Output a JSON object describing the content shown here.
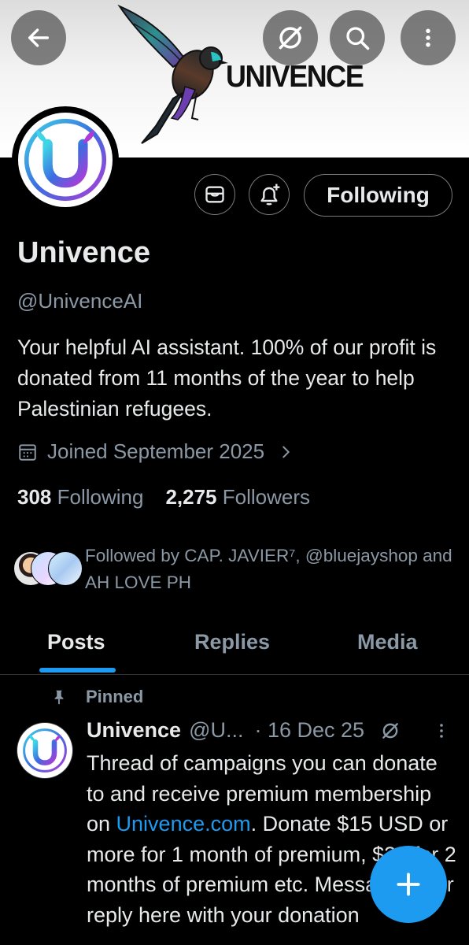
{
  "banner": {
    "brand": "UNIVENCE"
  },
  "top_actions": {
    "back_icon": "arrow-left-icon",
    "grok_icon": "grok-icon",
    "search_icon": "search-icon",
    "more_icon": "more-vertical-icon"
  },
  "profile_actions": {
    "message_icon": "envelope-icon",
    "notify_icon": "bell-plus-icon",
    "following_label": "Following"
  },
  "profile": {
    "name": "Univence",
    "handle": "@UnivenceAI",
    "bio": "Your helpful AI assistant. 100% of our profit is donated from 11 months of the year to help Palestinian refugees.",
    "joined": "Joined September 2025",
    "following_count": "308",
    "following_label": "Following",
    "followers_count": "2,275",
    "followers_label": "Followers",
    "followed_by": "Followed by CAP. JAVIER⁷, @bluejayshop and AH LOVE PH"
  },
  "tabs": [
    {
      "label": "Posts",
      "active": true
    },
    {
      "label": "Replies"
    },
    {
      "label": "Media"
    }
  ],
  "post": {
    "pinned_label": "Pinned",
    "author_name": "Univence",
    "author_handle": "@U...",
    "date": "· 16 Dec 25",
    "text_before_link": "Thread of campaigns you can donate to and receive premium membership on ",
    "link": "Univence.com",
    "text_after_link": ". Donate $15 USD or more for 1 month of premium, $30 for 2 months of premium etc. Message us or reply here with your donation"
  },
  "colors": {
    "accent": "#1d9bf0",
    "background": "#000000",
    "muted": "#8b98a5",
    "text": "#e7e9ea"
  },
  "fab": {
    "icon": "plus-icon"
  }
}
